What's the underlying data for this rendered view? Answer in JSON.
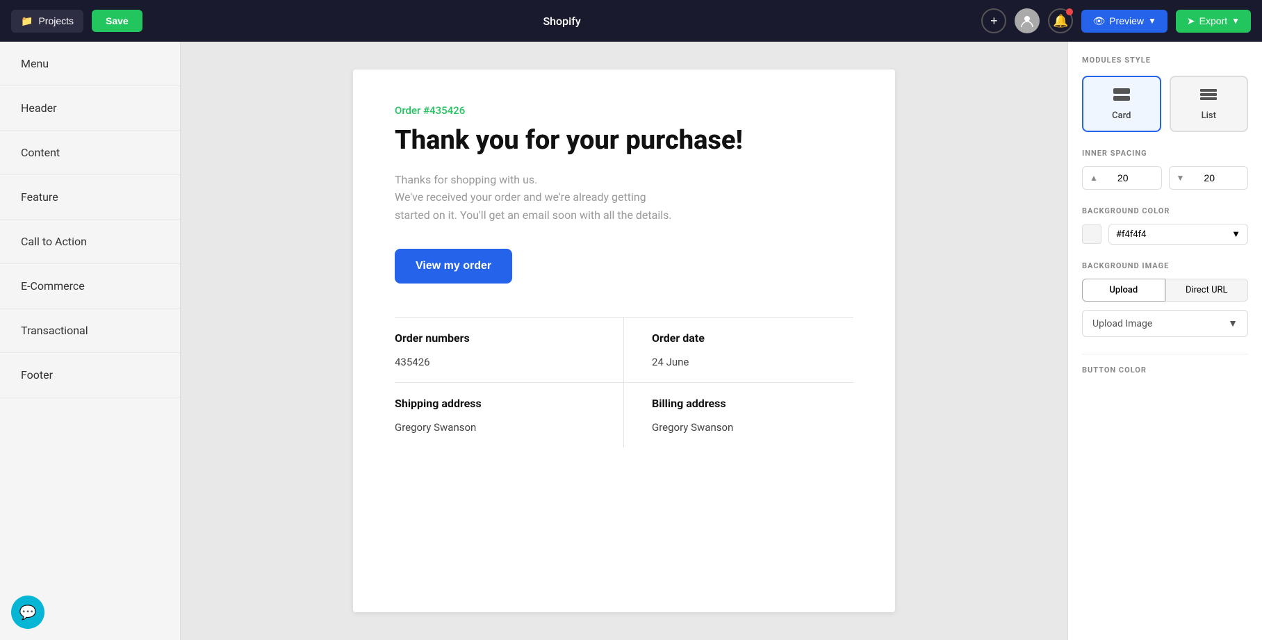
{
  "topbar": {
    "projects_label": "Projects",
    "save_label": "Save",
    "title": "Shopify",
    "preview_label": "Preview",
    "export_label": "Export"
  },
  "sidebar": {
    "items": [
      {
        "id": "menu",
        "label": "Menu"
      },
      {
        "id": "header",
        "label": "Header"
      },
      {
        "id": "content",
        "label": "Content"
      },
      {
        "id": "feature",
        "label": "Feature"
      },
      {
        "id": "call-to-action",
        "label": "Call to Action"
      },
      {
        "id": "e-commerce",
        "label": "E-Commerce"
      },
      {
        "id": "transactional",
        "label": "Transactional"
      },
      {
        "id": "footer",
        "label": "Footer"
      }
    ]
  },
  "email": {
    "order_label": "Order #435426",
    "title": "Thank you for your purchase!",
    "description_line1": "Thanks for shopping with us.",
    "description_line2": "We've received your order and we're already getting",
    "description_line3": "started on it. You'll get an email soon with all the details.",
    "cta_button": "View my order",
    "sections": [
      {
        "label": "Order numbers",
        "value": "435426"
      },
      {
        "label": "Order date",
        "value": "24 June"
      },
      {
        "label": "Shipping address",
        "value": "Gregory Swanson"
      },
      {
        "label": "Billing address",
        "value": "Gregory Swanson"
      }
    ]
  },
  "right_panel": {
    "modules_style_title": "MODULES STYLE",
    "module_card_label": "Card",
    "module_list_label": "List",
    "inner_spacing_title": "INNER SPACING",
    "spacing_top": "20",
    "spacing_bottom": "20",
    "bg_color_title": "BACKGROUND COLOR",
    "bg_color_value": "#f4f4f4",
    "bg_image_title": "BACKGROUND IMAGE",
    "bg_tab_upload": "Upload",
    "bg_tab_direct": "Direct URL",
    "upload_image_label": "Upload Image",
    "button_color_title": "BUTTON COLOR"
  }
}
